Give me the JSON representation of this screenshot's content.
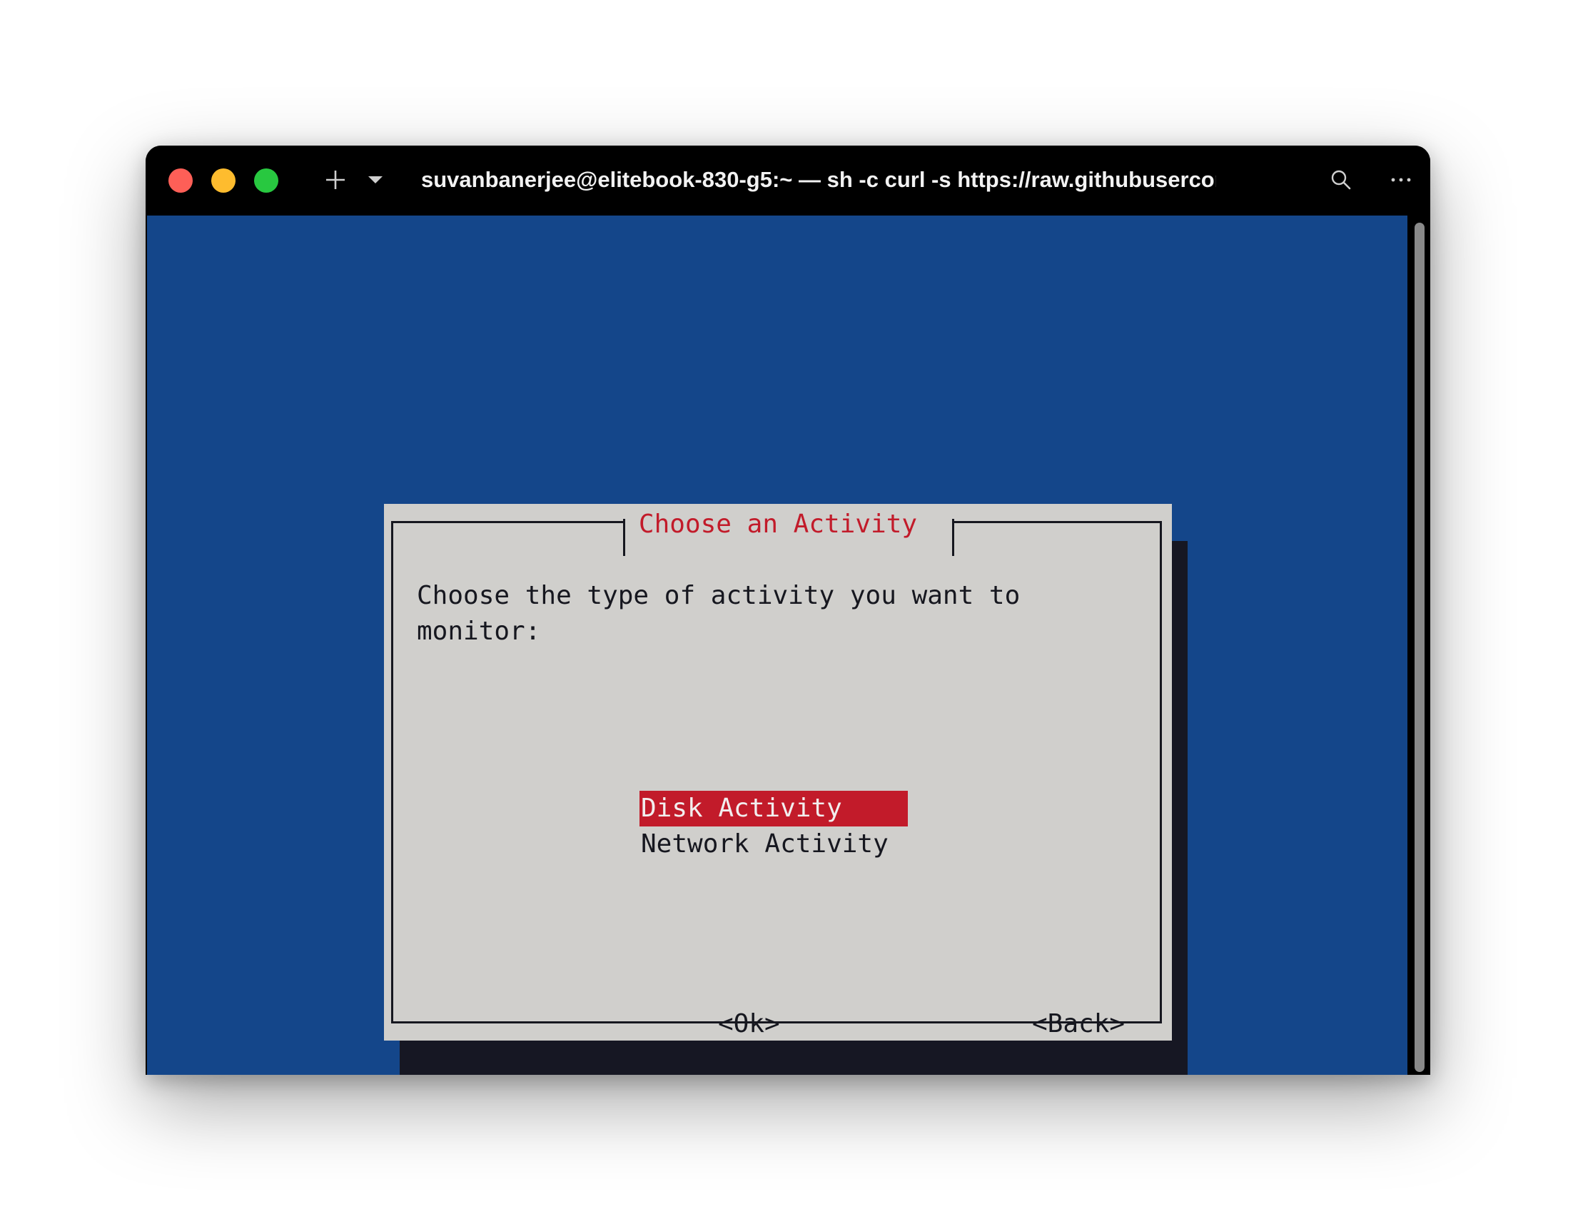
{
  "window": {
    "title": "suvanbanerjee@elitebook-830-g5:~ — sh -c curl -s https://raw.githubuserconte…"
  },
  "toolbar": {
    "icons": [
      "close-icon",
      "minimize-icon",
      "maximize-icon",
      "plus-icon",
      "chevron-down-icon",
      "search-icon",
      "more-icon"
    ]
  },
  "dialog": {
    "title": "Choose an Activity",
    "prompt": "Choose the type of activity you want to\nmonitor:",
    "menu": [
      {
        "label": "Disk Activity",
        "selected": true
      },
      {
        "label": "Network Activity",
        "selected": false
      }
    ],
    "ok_label": "<Ok>",
    "back_label": "<Back>"
  },
  "colors": {
    "terminal_bg": "#14468a",
    "dialog_bg": "#d0cfcc",
    "accent": "#c21b2a",
    "shadow": "#161723"
  }
}
